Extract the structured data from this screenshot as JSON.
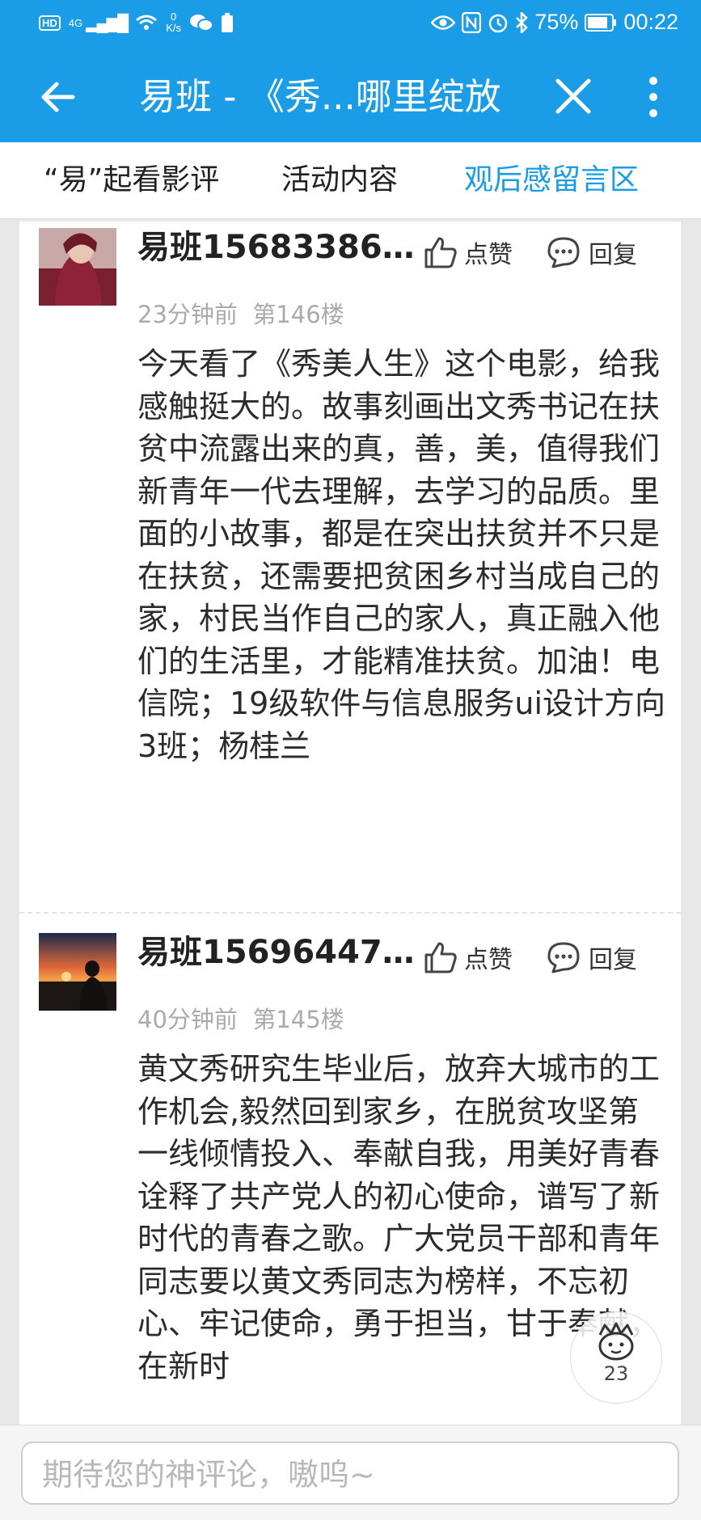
{
  "status_bar": {
    "network_badge": "HD",
    "network_type": "4G",
    "speed_value": "0",
    "speed_unit": "K/s",
    "battery_percent": "75%",
    "time": "00:22"
  },
  "app_bar": {
    "title": "易班 - 《秀...哪里绽放"
  },
  "tabs": [
    {
      "label": "“易”起看影评",
      "active": false
    },
    {
      "label": "活动内容",
      "active": false
    },
    {
      "label": "观后感留言区",
      "active": true
    }
  ],
  "actions": {
    "like_label": "点赞",
    "reply_label": "回复"
  },
  "comments": [
    {
      "author": "易班15683386...",
      "time": "23分钟前",
      "floor": "第146楼",
      "body": "今天看了《秀美人生》这个电影，给我感触挺大的。故事刻画出文秀书记在扶贫中流露出来的真，善，美，值得我们新青年一代去理解，去学习的品质。里面的小故事，都是在突出扶贫并不只是在扶贫，还需要把贫困乡村当成自己的家，村民当作自己的家人，真正融入他们的生活里，才能精准扶贫。加油！电信院；19级软件与信息服务ui设计方向3班；杨桂兰"
    },
    {
      "author": "易班15696447...",
      "time": "40分钟前",
      "floor": "第145楼",
      "body": "黄文秀研究生毕业后，放弃大城市的工作机会,毅然回到家乡，在脱贫攻坚第一线倾情投入、奉献自我，用美好青春诠释了共产党人的初心使命，谱写了新时代的青春之歌。广大党员干部和青年同志要以黄文秀同志为榜样，不忘初心、牢记使命，勇于担当，甘于奉献，在新时"
    }
  ],
  "floating_badge": {
    "count": "23"
  },
  "comment_input": {
    "placeholder": "期待您的神评论，嗷呜~"
  },
  "colors": {
    "accent": "#1a9ce6",
    "muted_text": "#aaaaaa"
  }
}
